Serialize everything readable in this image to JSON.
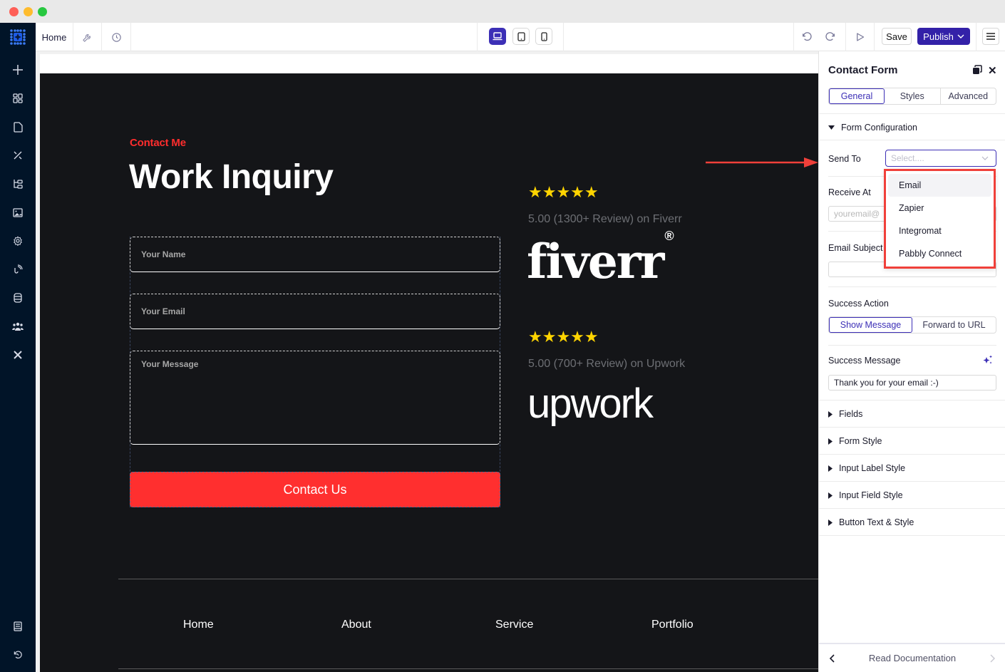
{
  "window": {
    "traffic_lights": [
      "close",
      "minimize",
      "maximize"
    ]
  },
  "topbar": {
    "home_label": "Home",
    "save_label": "Save",
    "publish_label": "Publish",
    "colors": {
      "accent": "#3321a8"
    }
  },
  "canvas": {
    "eyebrow": "Contact Me",
    "heading": "Work Inquiry",
    "form": {
      "name_placeholder": "Your Name",
      "email_placeholder": "Your Email",
      "message_placeholder": "Your Message",
      "submit_label": "Contact Us"
    },
    "reviews": [
      {
        "stars": "★★★★★",
        "rating_out_of_5": 5,
        "text": "5.00 (1300+ Review) on Fiverr",
        "logo": "fiverr"
      },
      {
        "stars": "★★★★★",
        "rating_out_of_5": 5,
        "text": "5.00 (700+ Review) on Upwork",
        "logo": "upwork"
      }
    ],
    "footer_links": [
      "Home",
      "About",
      "Service",
      "Portfolio"
    ],
    "colors": {
      "background": "#141518",
      "accent": "#ff2f2f",
      "star": "#ffd400"
    }
  },
  "panel": {
    "title": "Contact Form",
    "tabs": [
      "General",
      "Styles",
      "Advanced"
    ],
    "active_tab": "General",
    "section_open": "Form Configuration",
    "send_to": {
      "label": "Send To",
      "placeholder": "Select....",
      "options": [
        "Email",
        "Zapier",
        "Integromat",
        "Pabbly Connect"
      ],
      "hovered": "Email"
    },
    "receive_at": {
      "label": "Receive At",
      "placeholder": "youremail@"
    },
    "email_subject": {
      "label": "Email Subject",
      "value": ""
    },
    "success_action": {
      "label": "Success Action",
      "options": [
        "Show Message",
        "Forward to URL"
      ],
      "active": "Show Message"
    },
    "success_message": {
      "label": "Success Message",
      "value": "Thank you for your email :-)"
    },
    "collapsed_sections": [
      "Fields",
      "Form Style",
      "Input Label Style",
      "Input Field Style",
      "Button Text & Style"
    ],
    "doc_label": "Read Documentation"
  }
}
